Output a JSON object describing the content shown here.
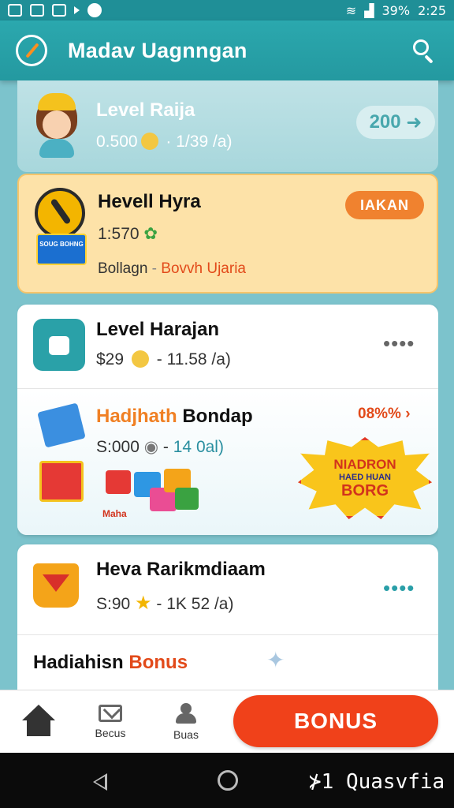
{
  "status_bar": {
    "battery": "39%",
    "time": "2:25"
  },
  "app_bar": {
    "title": "Madav Uagnngan"
  },
  "cards": [
    {
      "title": "Level Raija",
      "amount": "0.500",
      "separator": "·",
      "detail": "1/39 /a)",
      "points": "200"
    },
    {
      "title": "Hevell Hyra",
      "amount": "1:570",
      "footer_left": "Bollagn",
      "footer_sep": "-",
      "footer_right": "Bovvh Ujaria",
      "action_label": "IAKAN",
      "mini_badge": "SOUG BOHNG"
    },
    {
      "title": "Level Harajan",
      "amount": "$29",
      "separator": "-",
      "detail": "11.58 /a)"
    },
    {
      "title_left": "Hadjhath",
      "title_right": "Bondap",
      "amount": "S:000",
      "separator": "-",
      "detail": "14 0al)",
      "percent": "08%%",
      "gifts_label": "Maha",
      "burst": {
        "line1": "NIADRON",
        "line2": "HAED HUAN",
        "line3": "BORG"
      }
    },
    {
      "title": "Heva Rarikmdiaam",
      "amount": "S:90",
      "separator": "-",
      "detail": "1K 52 /a)",
      "footer_left": "Hadiahisn",
      "footer_right": "Bonus"
    }
  ],
  "bottom_nav": {
    "item1": "Becus",
    "item2": "Buas",
    "bonus_label": "BONUS"
  },
  "system_nav": {
    "recents_label": "⊁1 Quasvfia"
  },
  "colors": {
    "primary": "#2499a0",
    "accent": "#f0411a",
    "highlight": "#fde2a8"
  }
}
